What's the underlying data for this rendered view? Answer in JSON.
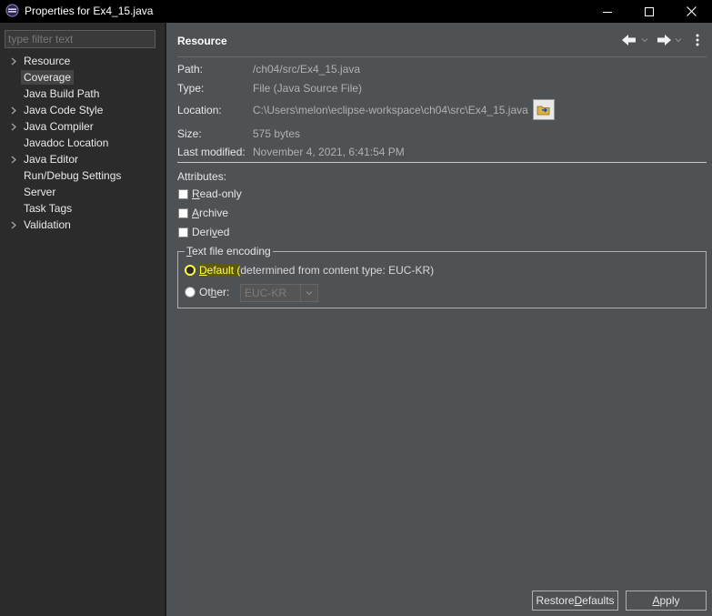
{
  "window": {
    "title": "Properties for Ex4_15.java"
  },
  "sidebar": {
    "filter_placeholder": "type filter text",
    "items": [
      {
        "label": "Resource",
        "expandable": true,
        "selected": false
      },
      {
        "label": "Coverage",
        "expandable": false,
        "selected": true
      },
      {
        "label": "Java Build Path",
        "expandable": false,
        "selected": false
      },
      {
        "label": "Java Code Style",
        "expandable": true,
        "selected": false
      },
      {
        "label": "Java Compiler",
        "expandable": true,
        "selected": false
      },
      {
        "label": "Javadoc Location",
        "expandable": false,
        "selected": false
      },
      {
        "label": "Java Editor",
        "expandable": true,
        "selected": false
      },
      {
        "label": "Run/Debug Settings",
        "expandable": false,
        "selected": false
      },
      {
        "label": "Server",
        "expandable": false,
        "selected": false
      },
      {
        "label": "Task Tags",
        "expandable": false,
        "selected": false
      },
      {
        "label": "Validation",
        "expandable": true,
        "selected": false
      }
    ]
  },
  "page": {
    "title": "Resource",
    "path_label": "Path:",
    "path_value": "/ch04/src/Ex4_15.java",
    "type_label": "Type:",
    "type_value": "File  (Java Source File)",
    "location_label": "Location:",
    "location_value": "C:\\Users\\melon\\eclipse-workspace\\ch04\\src\\Ex4_15.java",
    "size_label": "Size:",
    "size_value": "575  bytes",
    "modified_label": "Last modified:",
    "modified_value": "November 4, 2021, 6:41:54 PM",
    "attributes_label": "Attributes:",
    "attributes": {
      "read_only": {
        "mnemonic": "R",
        "rest": "ead-only",
        "checked": false
      },
      "archive": {
        "mnemonic": "A",
        "rest": "rchive",
        "checked": false
      },
      "derived": {
        "pre": "Deri",
        "mnemonic": "v",
        "rest": "ed",
        "checked": false
      }
    },
    "encoding": {
      "legend_mnemonic": "T",
      "legend_rest": "ext file encoding",
      "default_mnemonic": "D",
      "default_rest": "efault (",
      "default_tail": "determined from content type: EUC-KR)",
      "other_pre": "Ot",
      "other_mnemonic": "h",
      "other_rest": "er:",
      "selected_value": "EUC-KR"
    }
  },
  "buttons": {
    "restore_pre": "Restore ",
    "restore_mnemonic": "D",
    "restore_rest": "efaults",
    "apply_mnemonic": "A",
    "apply_rest": "pply"
  },
  "colors": {
    "sidebar_bg": "#2b2b2b",
    "main_bg": "#4f5254",
    "highlight": "#ffff3a"
  }
}
